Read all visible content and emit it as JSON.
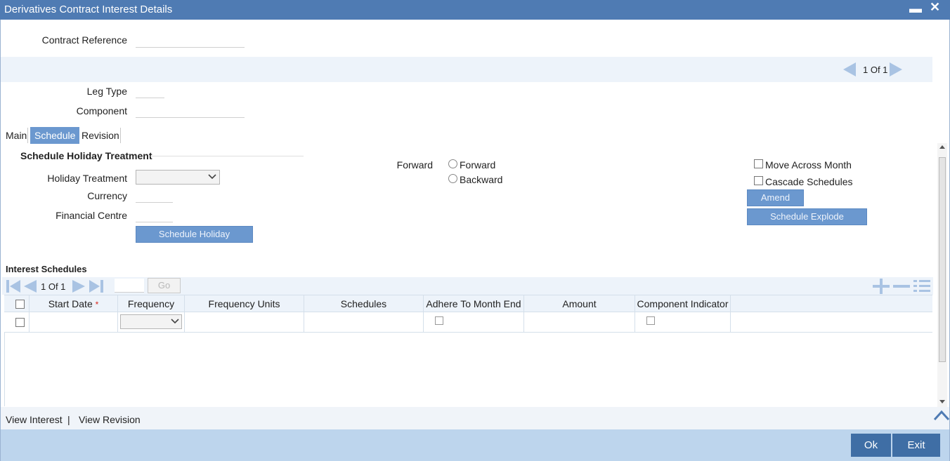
{
  "window": {
    "title": "Derivatives Contract Interest Details",
    "minimize": "▬",
    "close": "✕"
  },
  "header": {
    "contract_reference_label": "Contract Reference",
    "contract_reference_value": "",
    "pager_text": "1 Of 1",
    "leg_type_label": "Leg Type",
    "leg_type_value": "",
    "component_label": "Component",
    "component_value": ""
  },
  "tabs": [
    {
      "label": "Main",
      "active": false
    },
    {
      "label": "Schedule",
      "active": true
    },
    {
      "label": "Revision",
      "active": false
    }
  ],
  "holiday": {
    "section_title": "Schedule Holiday Treatment",
    "holiday_treatment_label": "Holiday Treatment",
    "holiday_treatment_value": "",
    "currency_label": "Currency",
    "currency_value": "",
    "financial_centre_label": "Financial Centre",
    "financial_centre_value": "",
    "schedule_holiday_button": "Schedule Holiday"
  },
  "direction": {
    "label": "Forward",
    "options": [
      "Forward",
      "Backward"
    ],
    "selected": ""
  },
  "options": {
    "move_across_month": "Move Across Month",
    "cascade_schedules": "Cascade Schedules",
    "amend_button": "Amend",
    "schedule_explode_button": "Schedule Explode"
  },
  "interest_schedules": {
    "title": "Interest Schedules",
    "pager_text": "1 Of 1",
    "go_button": "Go",
    "columns": [
      "Start Date",
      "Frequency",
      "Frequency Units",
      "Schedules",
      "Adhere To Month End",
      "Amount",
      "Component Indicator"
    ],
    "required_marker": "*",
    "rows": [
      {
        "start_date": "",
        "frequency": "",
        "frequency_units": "",
        "schedules": "",
        "adhere_to_month_end": false,
        "amount": "",
        "component_indicator": false
      }
    ]
  },
  "links": {
    "view_interest": "View Interest",
    "separator": "|",
    "view_revision": "View Revision"
  },
  "footer": {
    "ok": "Ok",
    "exit": "Exit"
  },
  "colors": {
    "titlebar": "#4f7bb3",
    "accent": "#6b98cf",
    "footer": "#bdd5ed",
    "footer_button": "#3f6ea5",
    "required": "#d9261c"
  }
}
